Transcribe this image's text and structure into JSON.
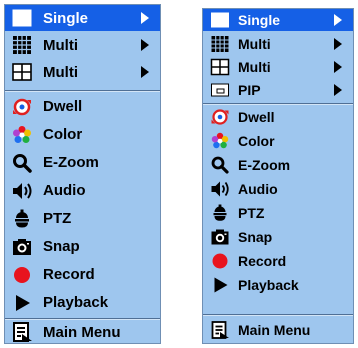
{
  "left_menu": {
    "items": [
      {
        "label": "Single",
        "icon": "white-box-icon",
        "arrow": true
      },
      {
        "label": "Multi",
        "icon": "grid-icon",
        "arrow": true
      },
      {
        "label": "Multi",
        "icon": "quad-icon",
        "arrow": true
      },
      {
        "label": "Dwell",
        "icon": "dwell-icon",
        "arrow": false
      },
      {
        "label": "Color",
        "icon": "color-icon",
        "arrow": false
      },
      {
        "label": "E-Zoom",
        "icon": "magnifier-icon",
        "arrow": false
      },
      {
        "label": "Audio",
        "icon": "speaker-icon",
        "arrow": false
      },
      {
        "label": "PTZ",
        "icon": "ptz-icon",
        "arrow": false
      },
      {
        "label": "Snap",
        "icon": "camera-icon",
        "arrow": false
      },
      {
        "label": "Record",
        "icon": "record-icon",
        "arrow": false
      },
      {
        "label": "Playback",
        "icon": "play-icon",
        "arrow": false
      },
      {
        "label": "Main Menu",
        "icon": "main-menu-icon",
        "arrow": false
      }
    ]
  },
  "right_menu": {
    "items": [
      {
        "label": "Single",
        "icon": "white-box-icon",
        "arrow": true
      },
      {
        "label": "Multi",
        "icon": "grid-icon",
        "arrow": true
      },
      {
        "label": "Multi",
        "icon": "quad-icon",
        "arrow": true
      },
      {
        "label": "PIP",
        "icon": "pip-icon",
        "arrow": true
      },
      {
        "label": "Dwell",
        "icon": "dwell-icon",
        "arrow": false
      },
      {
        "label": "Color",
        "icon": "color-icon",
        "arrow": false
      },
      {
        "label": "E-Zoom",
        "icon": "magnifier-icon",
        "arrow": false
      },
      {
        "label": "Audio",
        "icon": "speaker-icon",
        "arrow": false
      },
      {
        "label": "PTZ",
        "icon": "ptz-icon",
        "arrow": false
      },
      {
        "label": "Snap",
        "icon": "camera-icon",
        "arrow": false
      },
      {
        "label": "Record",
        "icon": "record-icon",
        "arrow": false
      },
      {
        "label": "Playback",
        "icon": "play-icon",
        "arrow": false
      },
      {
        "label": "Main Menu",
        "icon": "main-menu-icon",
        "arrow": false
      }
    ]
  },
  "colors": {
    "menu_background": "#9ec6ee",
    "selected_background": "#1560e6",
    "selected_text": "#ffffff",
    "record_red": "#e8141e",
    "dwell_red": "#e02020"
  }
}
